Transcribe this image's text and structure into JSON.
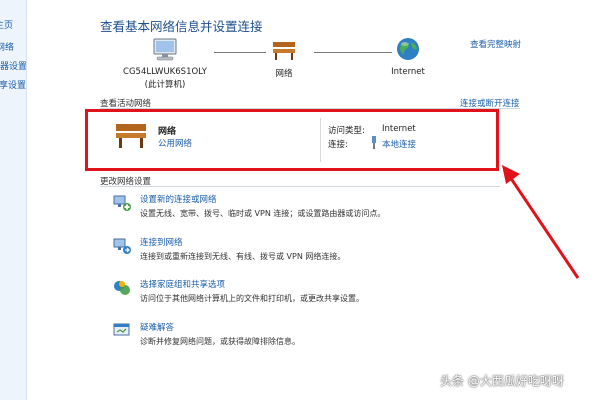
{
  "sidebar": {
    "items": [
      "主页",
      "网络",
      "适配器设置",
      "高级共享设置"
    ]
  },
  "header": {
    "title": "查看基本网络信息并设置连接",
    "see_full_map": "查看完整映射"
  },
  "map": {
    "computer_name": "CG54LLWUK6S1OLY",
    "computer_sub": "(此计算机)",
    "network_label": "网络",
    "internet_label": "Internet"
  },
  "active": {
    "section_label": "查看活动网络",
    "connect_link": "连接或断开连接",
    "network_name": "网络",
    "network_type": "公用网络",
    "access_type_label": "访问类型:",
    "access_type_value": "Internet",
    "connection_label": "连接:",
    "connection_value": "本地连接"
  },
  "change": {
    "section_label": "更改网络设置",
    "tasks": [
      {
        "title": "设置新的连接或网络",
        "desc": "设置无线、宽带、拨号、临时或 VPN 连接；或设置路由器或访问点。",
        "icon": "new-connection-icon"
      },
      {
        "title": "连接到网络",
        "desc": "连接到或重新连接到无线、有线、拨号或 VPN 网络连接。",
        "icon": "connect-network-icon"
      },
      {
        "title": "选择家庭组和共享选项",
        "desc": "访问位于其他网络计算机上的文件和打印机，或更改共享设置。",
        "icon": "homegroup-icon"
      },
      {
        "title": "疑难解答",
        "desc": "诊断并修复网络问题，或获得故障排除信息。",
        "icon": "troubleshoot-icon"
      }
    ]
  },
  "watermark": "头条 @大西瓜好吃呀呀",
  "colors": {
    "highlight": "#e0131b",
    "link": "#1a5ea8",
    "title": "#1e4f8e"
  }
}
